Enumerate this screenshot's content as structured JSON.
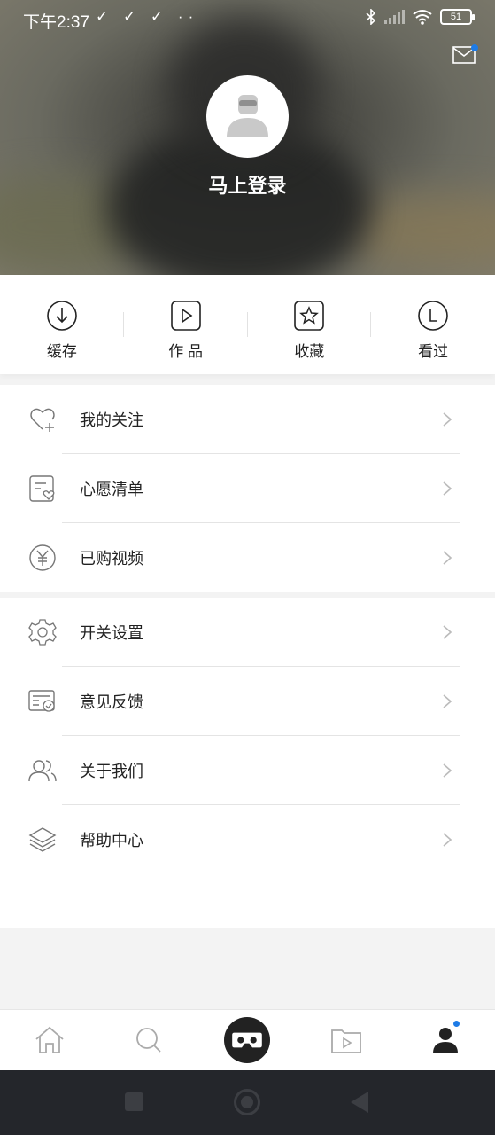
{
  "status_bar": {
    "time": "下午2:37",
    "left_icons": "✓ ✓ ✓ ··",
    "battery": "51"
  },
  "header": {
    "login_text": "马上登录",
    "mail_icon": "mail-icon",
    "notification_dot_color": "#1e7be6"
  },
  "quick_actions": [
    {
      "label": "缓存",
      "icon": "download-icon"
    },
    {
      "label": "作 品",
      "icon": "play-square-icon"
    },
    {
      "label": "收藏",
      "icon": "star-icon"
    },
    {
      "label": "看过",
      "icon": "history-icon"
    }
  ],
  "menu_group_1": [
    {
      "label": "我的关注",
      "icon": "heart-plus-icon"
    },
    {
      "label": "心愿清单",
      "icon": "wishlist-icon"
    },
    {
      "label": "已购视频",
      "icon": "yen-icon"
    }
  ],
  "menu_group_2": [
    {
      "label": "开关设置",
      "icon": "gear-icon"
    },
    {
      "label": "意见反馈",
      "icon": "feedback-icon"
    },
    {
      "label": "关于我们",
      "icon": "users-icon"
    },
    {
      "label": "帮助中心",
      "icon": "layers-icon"
    }
  ],
  "tabbar": [
    {
      "icon": "home-icon"
    },
    {
      "icon": "search-icon"
    },
    {
      "icon": "vr-icon"
    },
    {
      "icon": "video-folder-icon"
    },
    {
      "icon": "profile-icon",
      "active": true
    }
  ]
}
